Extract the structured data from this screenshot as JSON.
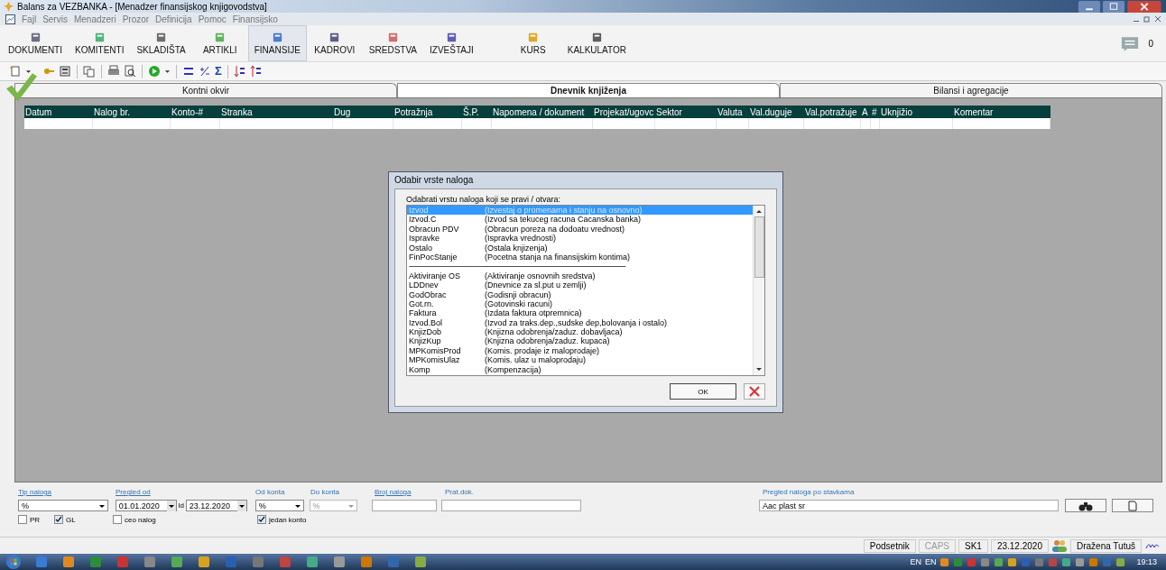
{
  "window": {
    "title": "Balans za VEZBANKA - [Menadzer finansijskog knjigovodstva]"
  },
  "menu": [
    "Fajl",
    "Servis",
    "Menadzeri",
    "Prozor",
    "Definicija",
    "Pomoc",
    "Finansijsko"
  ],
  "modules": [
    {
      "label": "DOKUMENTI",
      "selected": false
    },
    {
      "label": "KOMITENTI",
      "selected": false
    },
    {
      "label": "SKLADIŠTA",
      "selected": false
    },
    {
      "label": "ARTIKLI",
      "selected": false
    },
    {
      "label": "FINANSIJE",
      "selected": true
    },
    {
      "label": "KADROVI",
      "selected": false
    },
    {
      "label": "SREDSTVA",
      "selected": false
    },
    {
      "label": "IZVEŠTAJI",
      "selected": false
    },
    {
      "label": "KURS",
      "selected": false
    },
    {
      "label": "KALKULATOR",
      "selected": false
    }
  ],
  "messages_count": "0",
  "toolbar": {
    "sigma": "Σ"
  },
  "tabs": [
    {
      "label": "Kontni okvir",
      "selected": false
    },
    {
      "label": "Dnevnik knjiženja",
      "selected": true
    },
    {
      "label": "Bilansi i agregacije",
      "selected": false
    }
  ],
  "table": {
    "columns": [
      "Datum",
      "Nalog br.",
      "Konto-#",
      "Stranka",
      "Dug",
      "Potražnja",
      "Š.P.",
      "Napomena / dokument",
      "Projekat/ugovc",
      "Sektor",
      "Valuta",
      "Val.duguje",
      "Val.potražuje",
      "A",
      "#",
      "Uknjižio",
      "Komentar"
    ]
  },
  "dialog": {
    "title": "Odabir vrste naloga",
    "prompt": "Odabrati vrstu naloga koji se pravi / otvara:",
    "items": [
      {
        "kind": "item",
        "code": "Izvod",
        "description": "(Izvestaj o promenama i stanju na osnovno)",
        "selected": true
      },
      {
        "kind": "item",
        "code": "Izvod.C",
        "description": "(Izvod sa tekuceg racuna Cacanska banka)",
        "selected": false
      },
      {
        "kind": "item",
        "code": "Obracun PDV",
        "description": "(Obracun poreza na dodoatu vrednost)",
        "selected": false
      },
      {
        "kind": "item",
        "code": "Ispravke",
        "description": "(Ispravka vrednosti)",
        "selected": false
      },
      {
        "kind": "item",
        "code": "Ostalo",
        "description": "(Ostala knjizenja)",
        "selected": false
      },
      {
        "kind": "item",
        "code": "FinPocStanje",
        "description": "(Pocetna stanja na finansijskim kontima)",
        "selected": false
      },
      {
        "kind": "separator",
        "code": "------------------------------------------------------------------------------------------------------------------------",
        "selected": false
      },
      {
        "kind": "item",
        "code": "Aktiviranje OS",
        "description": "(Aktiviranje osnovnih sredstva)",
        "selected": false
      },
      {
        "kind": "item",
        "code": "LDDnev",
        "description": "(Dnevnice za sl.put u zemlji)",
        "selected": false
      },
      {
        "kind": "item",
        "code": "GodObrac",
        "description": "(Godisnji obracun)",
        "selected": false
      },
      {
        "kind": "item",
        "code": "Got.rn.",
        "description": "(Gotovinski racuni)",
        "selected": false
      },
      {
        "kind": "item",
        "code": "Faktura",
        "description": "(Izdata faktura otpremnica)",
        "selected": false
      },
      {
        "kind": "item",
        "code": "Izvod.Bol",
        "description": "(Izvod za traks.dep.,sudske dep,bolovanja i ostalo)",
        "selected": false
      },
      {
        "kind": "item",
        "code": "KnjizDob",
        "description": "(Knjizna odobrenja/zaduz. dobavljaca)",
        "selected": false
      },
      {
        "kind": "item",
        "code": "KnjizKup",
        "description": "(Knjizna odobrenja/zaduz. kupaca)",
        "selected": false
      },
      {
        "kind": "item",
        "code": "MPKomisProd",
        "description": "(Komis. prodaje iz maloprodaje)",
        "selected": false
      },
      {
        "kind": "item",
        "code": "MPKomisUlaz",
        "description": "(Komis. ulaz u maloprodaju)",
        "selected": false
      },
      {
        "kind": "item",
        "code": "Komp",
        "description": "(Kompenzacija)",
        "selected": false
      }
    ],
    "ok_label": "OK"
  },
  "filters": {
    "tip_label": "Tip naloga",
    "tip_value": "%",
    "pregled_label": "Pregled od",
    "date_from": "01.01.2020",
    "date_sep": "ld",
    "date_to": "23.12.2020",
    "od_konta_label": "Od konta",
    "od_konta_value": "%",
    "do_konta_label": "Do konta",
    "do_konta_value": "%",
    "do_konta_disabled": true,
    "broj_label": "Broj naloga",
    "prat_label": "Prat.dok.",
    "stavke_label": "Pregled naloga po stavkama",
    "stavke_value": "Aac plast sr",
    "checks": [
      {
        "label": "PR",
        "checked": false
      },
      {
        "label": "GL",
        "checked": true
      },
      {
        "label": "ceo nalog",
        "checked": false
      },
      {
        "label": "jedan konto",
        "checked": true
      }
    ]
  },
  "status_bar": {
    "reminder": "Podsetnik",
    "caps": "CAPS",
    "caps_disabled": true,
    "code": "SK1",
    "date": "23.12.2020",
    "user": "Dražena Tutuš"
  },
  "taskbar": {
    "languages": [
      "EN",
      "EN"
    ],
    "time": "19:13"
  }
}
